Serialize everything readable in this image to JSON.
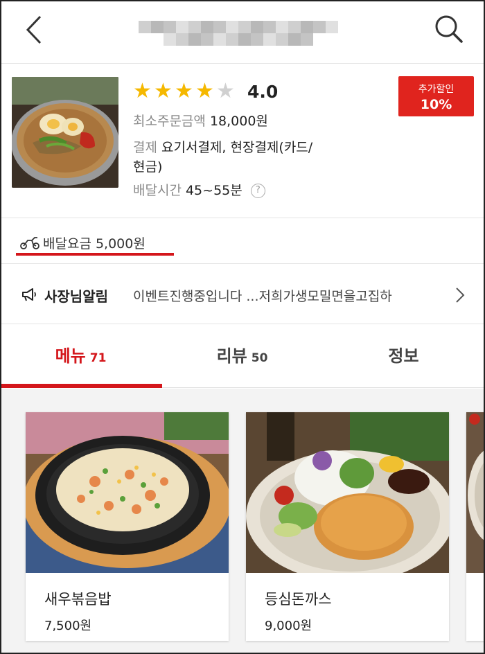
{
  "header": {
    "back_icon": "chevron-left-icon",
    "search_icon": "search-icon",
    "title_obscured": true
  },
  "restaurant": {
    "rating_stars": 4,
    "rating_value": "4.0",
    "discount_label": "추가할인",
    "discount_value": "10%",
    "min_order_label": "최소주문금액",
    "min_order_value": "18,000원",
    "payment_label": "결제",
    "payment_value_line1": "요기서결제, 현장결제(카드/",
    "payment_value_line2": "현금)",
    "delivery_time_label": "배달시간",
    "delivery_time_value": "45~55분",
    "help_symbol": "?"
  },
  "delivery_fee": {
    "text": "배달요금 5,000원",
    "icon": "scooter-icon"
  },
  "notice": {
    "icon": "megaphone-icon",
    "label": "사장님알림",
    "text": "이벤트진행중입니다 ...저희가생모밀면을고집하",
    "arrow_icon": "chevron-right-icon"
  },
  "tabs": [
    {
      "label": "메뉴",
      "count": "71",
      "active": true
    },
    {
      "label": "리뷰",
      "count": "50",
      "active": false
    },
    {
      "label": "정보",
      "count": "",
      "active": false
    }
  ],
  "menu_items": [
    {
      "name": "새우볶음밥",
      "price": "7,500원"
    },
    {
      "name": "등심돈까스",
      "price": "9,000원"
    }
  ],
  "colors": {
    "accent": "#d4161b",
    "discount_bg": "#e0241e",
    "star": "#f5b800",
    "star_empty": "#d0d0d0"
  }
}
